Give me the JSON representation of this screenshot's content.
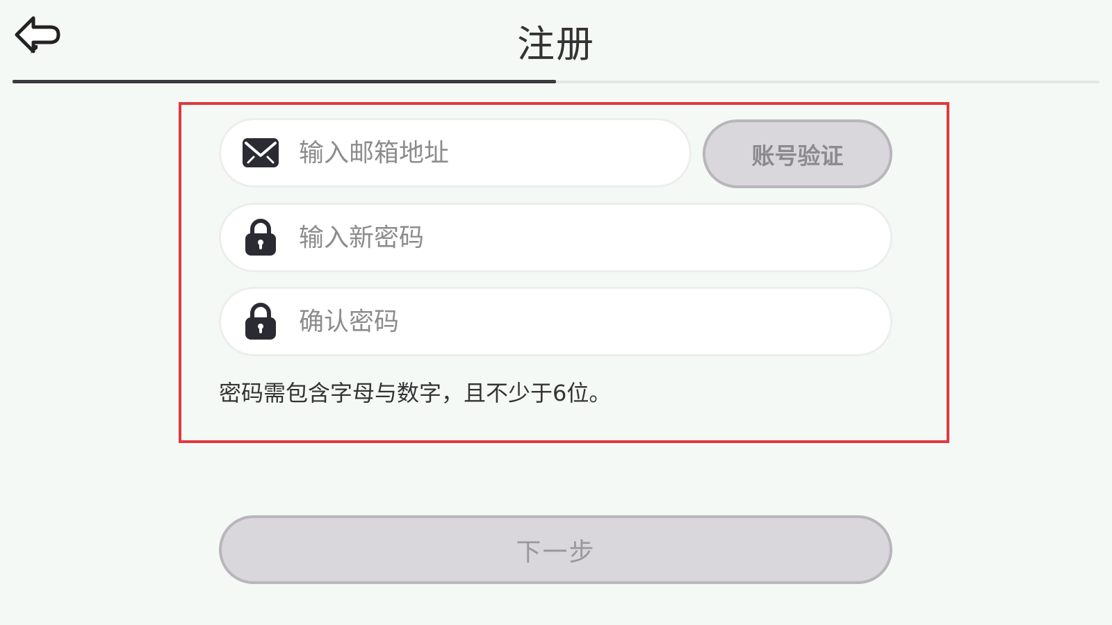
{
  "header": {
    "back_icon": "back-arrow-icon",
    "title": "注册",
    "progress": 0.5
  },
  "form": {
    "email": {
      "icon": "envelope-icon",
      "placeholder": "输入邮箱地址",
      "value": ""
    },
    "verify_button_label": "账号验证",
    "password": {
      "icon": "lock-icon",
      "placeholder": "输入新密码",
      "value": ""
    },
    "confirm_password": {
      "icon": "lock-icon",
      "placeholder": "确认密码",
      "value": ""
    },
    "hint": "密码需包含字母与数字，且不少于6位。"
  },
  "footer": {
    "next_button_label": "下一步"
  },
  "colors": {
    "background": "#f5f9f6",
    "highlight_border": "#e0393e",
    "disabled_button": "#d9d7db",
    "progress_fill": "#3a3a3f"
  }
}
